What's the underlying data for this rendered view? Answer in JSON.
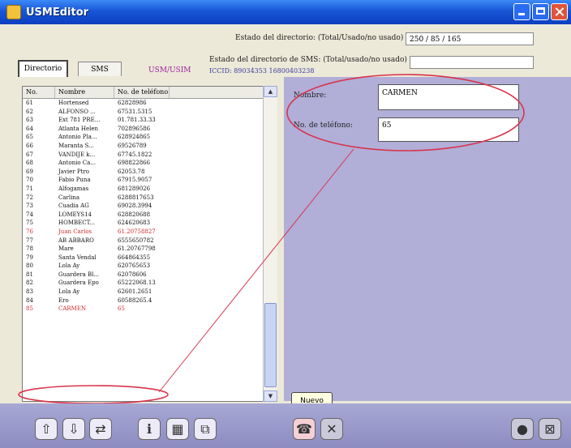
{
  "window": {
    "title": "USMEditor"
  },
  "header": {
    "dir_status_label": "Estado del directorio: (Total/Usado/no usado)",
    "dir_status_value": "250 / 85 / 165",
    "sms_status_label": "Estado del directorio de SMS: (Total/usado/no usado)",
    "iccid": "ICCID: 89034353 16800403238"
  },
  "tabs": {
    "directory": "Directorio",
    "sms": "SMS",
    "usim": "USM/USIM"
  },
  "list": {
    "columns": [
      "No.",
      "Nombre",
      "No. de teléfono"
    ],
    "rows": [
      [
        "61",
        "Hortensed",
        "62828986"
      ],
      [
        "62",
        "ALFONSO ...",
        "67531.5315"
      ],
      [
        "63",
        "Ext 781 PRE...",
        "01.781.33.33"
      ],
      [
        "64",
        "Atlanta Helen",
        "702896586"
      ],
      [
        "65",
        "Antonio Pla...",
        "628924865"
      ],
      [
        "66",
        "Maranta S...",
        "69526789"
      ],
      [
        "67",
        "VANDIJE k...",
        "67745.1822"
      ],
      [
        "68",
        "Antonio Ca...",
        "698822866"
      ],
      [
        "69",
        "Javier Ptro",
        "62053.78"
      ],
      [
        "70",
        "Fabio Puna",
        "67915.9057"
      ],
      [
        "71",
        "Alfogamas",
        "681289026"
      ],
      [
        "72",
        "Carlina",
        "6288817653"
      ],
      [
        "73",
        "Cuadia AG",
        "69028.3994"
      ],
      [
        "74",
        "LOMEYS14",
        "628820688"
      ],
      [
        "75",
        "HOMBECT...",
        "624620683"
      ],
      [
        "76",
        "Juan Carlos",
        "61.20758827"
      ],
      [
        "77",
        "AB ABBARO",
        "6555650782"
      ],
      [
        "78",
        "Mare",
        "61.20767798"
      ],
      [
        "79",
        "Santa Vendal",
        "664864355"
      ],
      [
        "80",
        "Lola Ay",
        "620765653"
      ],
      [
        "81",
        "Guardera Bl...",
        "62078606"
      ],
      [
        "82",
        "Guardera Epo",
        "65222068.13"
      ],
      [
        "83",
        "Lola Ay",
        "62601.2651"
      ],
      [
        "84",
        "Ero",
        "60588265.4"
      ],
      [
        "85",
        "CARMEN",
        "65"
      ]
    ],
    "red_rows": [
      "76",
      "85"
    ]
  },
  "detail": {
    "name_label": "Nombre:",
    "name_value": "CARMEN",
    "phone_label": "No. de teléfono:",
    "phone_value": "65"
  },
  "tooltip": "Nuevo",
  "colors": {
    "titlebar": "#1756d8",
    "detail_panel": "#b1aed8",
    "highlight": "#d12a2a"
  },
  "toolbar": {
    "buttons": [
      "upload-icon",
      "download-icon",
      "transfer-icon",
      "info-icon",
      "grid-icon",
      "copy-icon",
      "new-contact-icon",
      "delete-icon",
      "globe-icon",
      "close-icon"
    ]
  }
}
